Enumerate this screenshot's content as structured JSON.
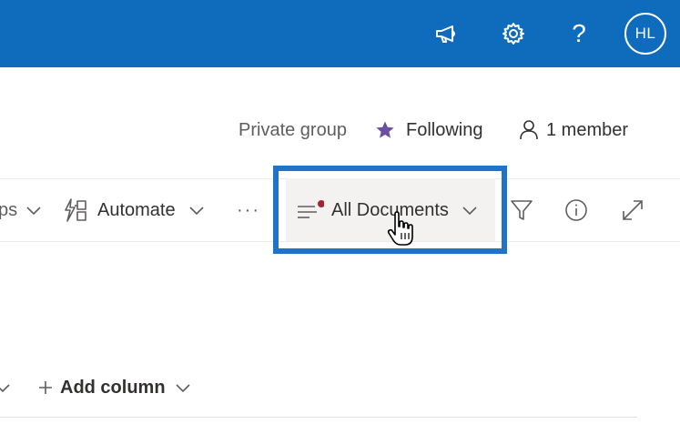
{
  "header": {
    "avatar_initials": "HL",
    "help_glyph": "?",
    "icons": [
      "megaphone-icon",
      "gear-icon",
      "help-icon"
    ]
  },
  "group": {
    "privacy": "Private group",
    "following_label": "Following",
    "members_label": "1 member"
  },
  "command_bar": {
    "apps_partial": "ps",
    "automate_label": "Automate",
    "more_label": "···",
    "view_label": "All Documents"
  },
  "columns": {
    "add_column_label": "Add column"
  },
  "colors": {
    "brand_blue": "#0f6cbd",
    "highlight_blue": "#1f73c9",
    "star_purple": "#6b4fa0",
    "unsaved_dot": "#a4262c"
  }
}
